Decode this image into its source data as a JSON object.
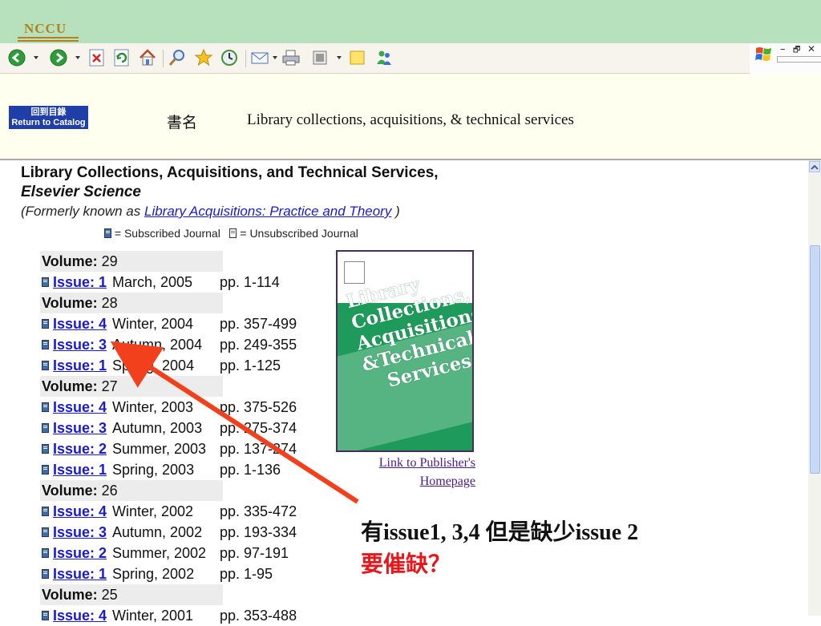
{
  "logo": {
    "text": "NCCU"
  },
  "toolbar": {
    "icons": [
      "back-icon",
      "forward-icon",
      "stop-icon",
      "refresh-icon",
      "home-icon",
      "search-icon",
      "favorites-icon",
      "history-icon",
      "mail-icon",
      "print-icon",
      "edit-icon",
      "folder-icon",
      "messenger-icon"
    ]
  },
  "window": {
    "controls": [
      "minimize",
      "restore",
      "close"
    ],
    "min_glyph": "–",
    "restore_glyph": "🗗",
    "close_glyph": "✕"
  },
  "header": {
    "return_line1": "回到目錄",
    "return_line2": "Return to Catalog",
    "book_label": "書名",
    "book_title": "Library collections, acquisitions, & technical services"
  },
  "journal": {
    "heading_main": "Library Collections, Acquisitions, and Technical Services,",
    "heading_publisher": "Elsevier Science",
    "former_prefix": "(Formerly known as",
    "former_link": "Library Acquisitions: Practice and Theory",
    "former_suffix": ")",
    "legend_subscribed": "= Subscribed Journal",
    "legend_unsubscribed": "= Unsubscribed Journal"
  },
  "volume_label": "Volume:",
  "volumes": [
    {
      "volume": "29",
      "issues": [
        {
          "issue": "Issue: 1",
          "date": "March, 2005",
          "pages": "pp. 1-114"
        }
      ]
    },
    {
      "volume": "28",
      "issues": [
        {
          "issue": "Issue: 4",
          "date": "Winter, 2004",
          "pages": "pp. 357-499"
        },
        {
          "issue": "Issue: 3",
          "date": "Autumn, 2004",
          "pages": "pp. 249-355"
        },
        {
          "issue": "Issue: 1",
          "date": "Spring, 2004",
          "pages": "pp. 1-125"
        }
      ]
    },
    {
      "volume": "27",
      "issues": [
        {
          "issue": "Issue: 4",
          "date": "Winter, 2003",
          "pages": "pp. 375-526"
        },
        {
          "issue": "Issue: 3",
          "date": "Autumn, 2003",
          "pages": "pp. 275-374"
        },
        {
          "issue": "Issue: 2",
          "date": "Summer, 2003",
          "pages": "pp. 137-274"
        },
        {
          "issue": "Issue: 1",
          "date": "Spring, 2003",
          "pages": "pp. 1-136"
        }
      ]
    },
    {
      "volume": "26",
      "issues": [
        {
          "issue": "Issue: 4",
          "date": "Winter, 2002",
          "pages": "pp. 335-472"
        },
        {
          "issue": "Issue: 3",
          "date": "Autumn, 2002",
          "pages": "pp. 193-334"
        },
        {
          "issue": "Issue: 2",
          "date": "Summer, 2002",
          "pages": "pp. 97-191"
        },
        {
          "issue": "Issue: 1",
          "date": "Spring, 2002",
          "pages": "pp. 1-95"
        }
      ]
    },
    {
      "volume": "25",
      "issues": [
        {
          "issue": "Issue: 4",
          "date": "Winter, 2001",
          "pages": "pp. 353-488"
        }
      ]
    }
  ],
  "cover": {
    "line1": "Library",
    "line2": "Collections,",
    "line3": "Acquisitions,",
    "line4": "&Technical",
    "line5": "Services"
  },
  "publisher_link": {
    "line1": "Link to Publisher's",
    "line2": "Homepage"
  },
  "annotation": {
    "line1": "有issue1, 3,4 但是缺少issue 2",
    "line2": "要催缺？",
    "arrow_color": "#f2401c",
    "line2_color": "#e8161b"
  },
  "colors": {
    "topbar": "#b7e0bc",
    "header_band": "#fffff0",
    "link": "#1a1ad0",
    "cover_green": "#1e9b5a"
  }
}
